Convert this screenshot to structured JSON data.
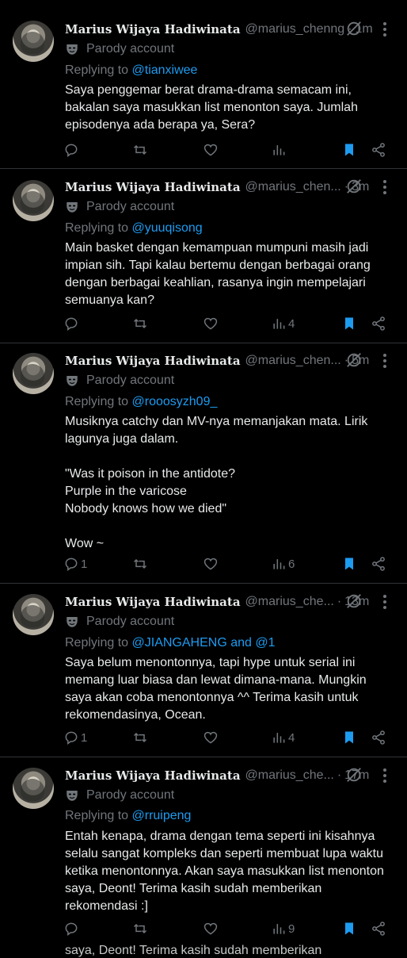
{
  "author": {
    "name": "Marius Wijaya Hadiwinata",
    "parody_label": "Parody account"
  },
  "replying_prefix": "Replying to",
  "tweets": [
    {
      "handle": "@marius_chenng",
      "time": "1m",
      "reply_target": "@tianxiwee",
      "text": "Saya penggemar berat drama-drama semacam ini,\nbakalan saya masukkan list menonton saya. Jumlah\nepisodenya ada berapa ya, Sera?",
      "replies": "",
      "views": ""
    },
    {
      "handle": "@marius_chen...",
      "time": "3m",
      "reply_target": "@yuuqisong",
      "text": "Main basket dengan kemampuan mumpuni masih jadi\nimpian sih. Tapi kalau bertemu dengan berbagai orang\ndengan berbagai keahlian, rasanya ingin mempelajari\nsemuanya kan?",
      "replies": "",
      "views": "4"
    },
    {
      "handle": "@marius_chen...",
      "time": "5m",
      "reply_target": "@rooosyzh09_",
      "text": "Musiknya catchy dan MV-nya memanjakan mata. Lirik\nlagunya juga dalam.\n\n\"Was it poison in the antidote?\nPurple in the varicose\nNobody knows how we died\"\n\nWow ~",
      "replies": "1",
      "views": "6"
    },
    {
      "handle": "@marius_che...",
      "time": "13m",
      "reply_target": "@JIANGAHENG and @1",
      "text": "Saya belum menontonnya, tapi hype untuk serial ini\nmemang luar biasa dan lewat dimana-mana. Mungkin\nsaya akan coba menontonnya ^^ Terima kasih untuk\nrekomendasinya, Ocean.",
      "replies": "1",
      "views": "4"
    },
    {
      "handle": "@marius_che...",
      "time": "17m",
      "reply_target": "@rruipeng",
      "text": "Entah kenapa, drama dengan tema seperti ini kisahnya\nselalu sangat kompleks dan seperti membuat lupa waktu\nketika menontonnya. Akan saya masukkan list menonton\nsaya, Deont! Terima kasih sudah memberikan\nrekomendasi :]",
      "replies": "",
      "views": "9"
    }
  ],
  "cut_off_text": "saya, Deont! Terima kasih sudah memberikan",
  "colors": {
    "accent": "#1d9bf0",
    "muted": "#71767b",
    "text": "#e7e9ea",
    "divider": "#2f3336",
    "bg": "#000000"
  },
  "icons": [
    "grok-icon",
    "more-icon",
    "parody-mask-icon",
    "reply-icon",
    "retweet-icon",
    "like-icon",
    "views-icon",
    "bookmark-icon",
    "share-icon"
  ]
}
